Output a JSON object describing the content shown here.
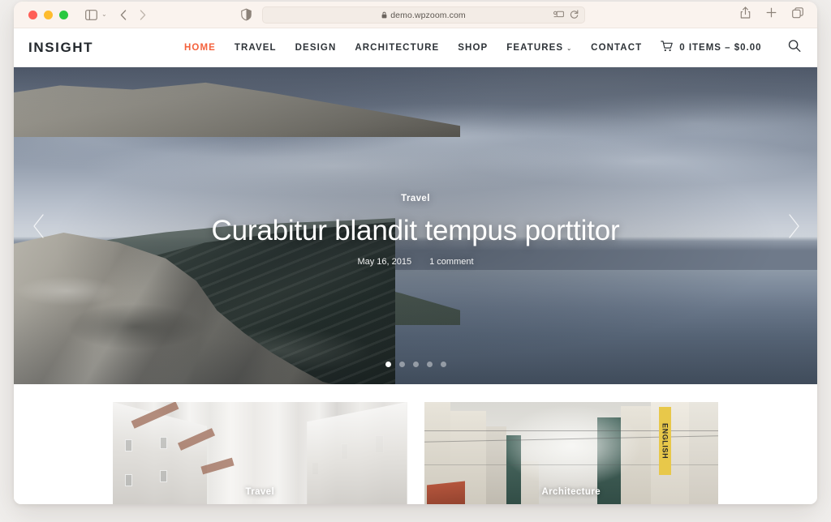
{
  "browser": {
    "traffic_lights": [
      "close",
      "minimize",
      "zoom"
    ],
    "sidebar_icon": "sidebar-icon",
    "back_icon": "chevron-left-icon",
    "forward_icon": "chevron-right-icon",
    "shield_icon": "privacy-shield-icon",
    "url": "demo.wpzoom.com",
    "lock_icon": "lock-icon",
    "extensions_icon": "extensions-icon",
    "reload_icon": "reload-icon",
    "share_icon": "share-icon",
    "new_tab_icon": "plus-icon",
    "tabs_overview_icon": "tabs-overview-icon"
  },
  "site": {
    "logo": "INSIGHT",
    "nav": [
      {
        "label": "HOME",
        "active": true,
        "has_caret": false
      },
      {
        "label": "TRAVEL",
        "active": false,
        "has_caret": false
      },
      {
        "label": "DESIGN",
        "active": false,
        "has_caret": false
      },
      {
        "label": "ARCHITECTURE",
        "active": false,
        "has_caret": false
      },
      {
        "label": "SHOP",
        "active": false,
        "has_caret": false
      },
      {
        "label": "FEATURES",
        "active": false,
        "has_caret": true
      },
      {
        "label": "CONTACT",
        "active": false,
        "has_caret": false
      }
    ],
    "caret_glyph": "⌄",
    "cart": {
      "icon": "shopping-cart-icon",
      "label": "0 ITEMS – $0.00",
      "item_count": "0",
      "total": "$0.00"
    },
    "search_icon": "search-icon",
    "active_color": "#f4613c"
  },
  "hero": {
    "category": "Travel",
    "title": "Curabitur blandit tempus porttitor",
    "date": "May 16, 2015",
    "comments": "1 comment",
    "prev_icon": "chevron-left-icon",
    "next_icon": "chevron-right-icon",
    "dots": [
      {
        "active": true
      },
      {
        "active": false
      },
      {
        "active": false
      },
      {
        "active": false
      },
      {
        "active": false
      }
    ],
    "slide_count": "5",
    "current_slide": "1"
  },
  "posts": [
    {
      "category": "Travel",
      "image_alt": "white wooden Nordic houses along a narrow street"
    },
    {
      "category": "Architecture",
      "image_alt": "European city street with overhead wires and a yellow ENGLISH sign"
    }
  ],
  "card2_sign_text": "ENGLISH"
}
